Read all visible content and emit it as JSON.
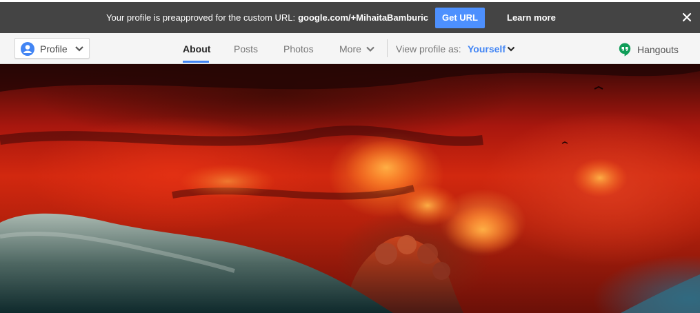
{
  "notification": {
    "text": "Your profile is preapproved for the custom URL:",
    "url": "google.com/+MihaitaBamburic",
    "get_url_label": "Get URL",
    "learn_more_label": "Learn more",
    "close_icon": "close-icon"
  },
  "nav": {
    "profile_label": "Profile",
    "tabs": [
      {
        "label": "About",
        "active": true
      },
      {
        "label": "Posts",
        "active": false
      },
      {
        "label": "Photos",
        "active": false
      },
      {
        "label": "More",
        "active": false
      }
    ],
    "view_as_label": "View profile as:",
    "view_as_value": "Yourself",
    "hangouts_label": "Hangouts"
  },
  "colors": {
    "accent": "#4285f4",
    "button": "#4d90fe",
    "notification_bg": "#444444",
    "hangouts_green": "#0f9d58"
  }
}
